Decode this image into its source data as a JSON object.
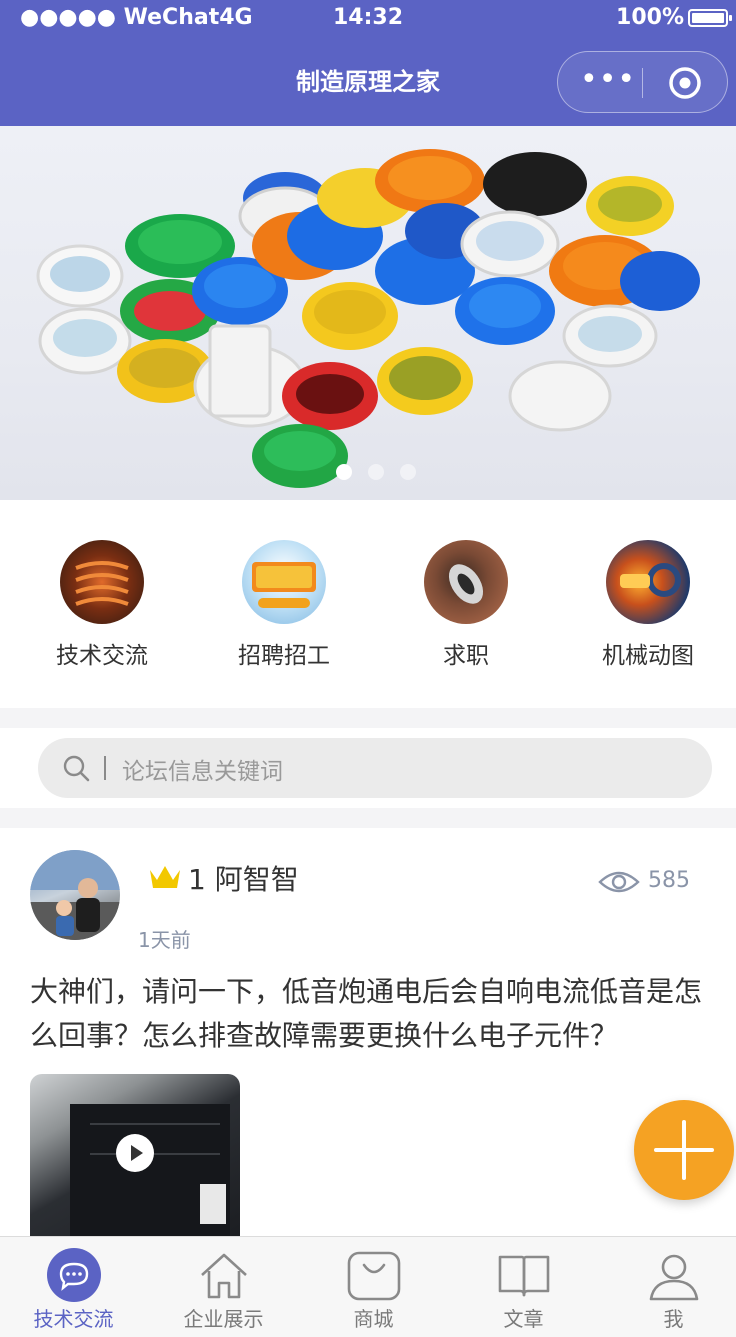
{
  "status_bar": {
    "carrier": "●●●●● WeChat4G",
    "time": "14:32",
    "battery": "100%"
  },
  "nav": {
    "title": "制造原理之家"
  },
  "banner": {
    "slides_total": 3,
    "active_slide": 1
  },
  "quick_menu": [
    {
      "label": "技术交流",
      "icon": "coil-photo-icon"
    },
    {
      "label": "招聘招工",
      "icon": "recruit-badge-icon"
    },
    {
      "label": "求职",
      "icon": "job-photo-icon"
    },
    {
      "label": "机械动图",
      "icon": "machine-gif-icon"
    }
  ],
  "search": {
    "placeholder": "论坛信息关键词"
  },
  "post": {
    "level": "1",
    "username": "阿智智",
    "time": "1天前",
    "views": "585",
    "content": "大神们，请问一下，低音炮通电后会自响电流低音是怎么回事？怎么排查故障需要更换什么电子元件？"
  },
  "tabs": [
    {
      "label": "技术交流",
      "icon": "chat-bubble-icon",
      "active": true
    },
    {
      "label": "企业展示",
      "icon": "home-icon",
      "active": false
    },
    {
      "label": "商城",
      "icon": "shopping-bag-icon",
      "active": false
    },
    {
      "label": "文章",
      "icon": "book-icon",
      "active": false
    },
    {
      "label": "我",
      "icon": "user-icon",
      "active": false
    }
  ],
  "colors": {
    "brand": "#5b63c4",
    "fab": "#f5a223",
    "muted": "#8a94a8"
  }
}
